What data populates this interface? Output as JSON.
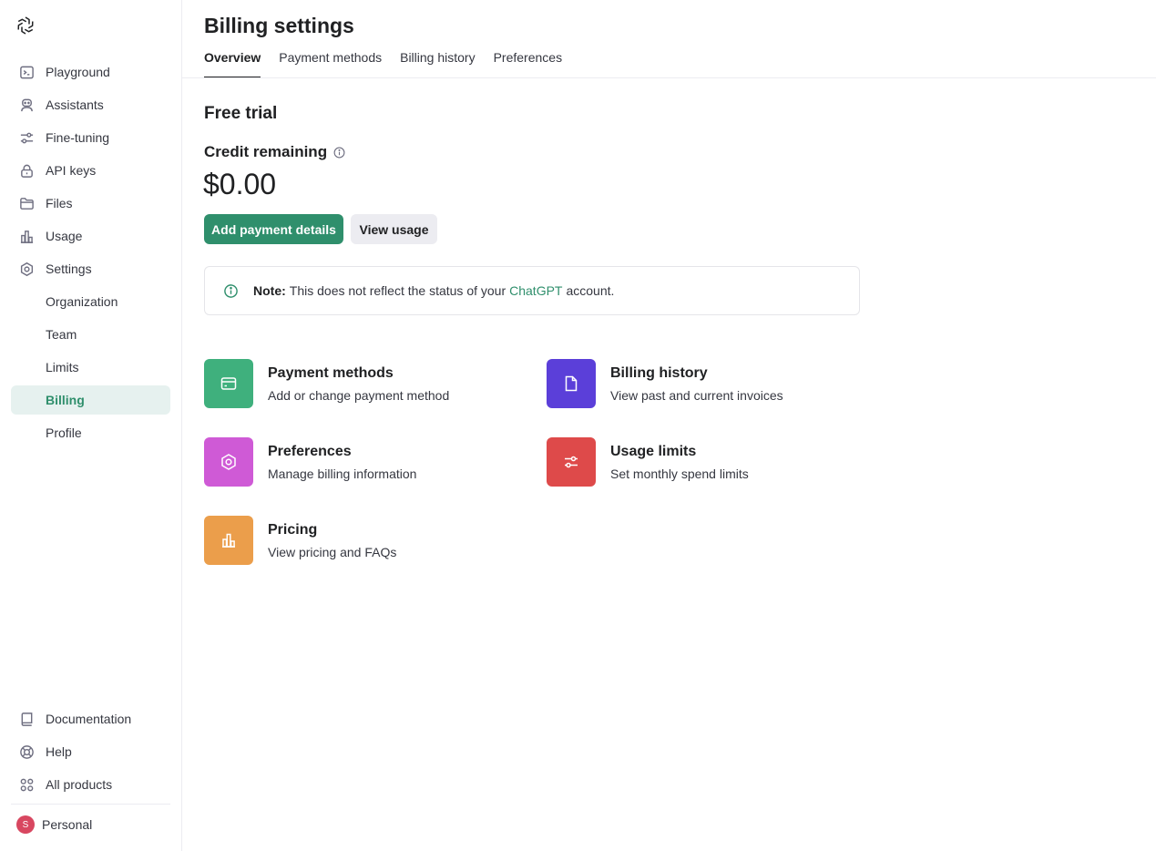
{
  "sidebar": {
    "nav": [
      {
        "label": "Playground",
        "icon": "terminal-icon"
      },
      {
        "label": "Assistants",
        "icon": "robot-icon"
      },
      {
        "label": "Fine-tuning",
        "icon": "sliders-icon"
      },
      {
        "label": "API keys",
        "icon": "lock-icon"
      },
      {
        "label": "Files",
        "icon": "folder-icon"
      },
      {
        "label": "Usage",
        "icon": "bar-chart-icon"
      },
      {
        "label": "Settings",
        "icon": "gear-icon"
      }
    ],
    "settings_sub": [
      "Organization",
      "Team",
      "Limits",
      "Billing",
      "Profile"
    ],
    "active_sub": "Billing",
    "bottom": [
      {
        "label": "Documentation",
        "icon": "book-icon"
      },
      {
        "label": "Help",
        "icon": "lifebuoy-icon"
      },
      {
        "label": "All products",
        "icon": "grid-icon"
      }
    ],
    "account": {
      "initial": "S",
      "label": "Personal"
    }
  },
  "header": {
    "title": "Billing settings",
    "tabs": [
      "Overview",
      "Payment methods",
      "Billing history",
      "Preferences"
    ],
    "active_tab": "Overview"
  },
  "overview": {
    "plan": "Free trial",
    "credit_label": "Credit remaining",
    "credit_amount": "$0.00",
    "primary_button": "Add payment details",
    "secondary_button": "View usage",
    "note": {
      "bold": "Note:",
      "text_before": "This does not reflect the status of your",
      "link": "ChatGPT",
      "text_after": "account."
    }
  },
  "cards": [
    {
      "title": "Payment methods",
      "desc": "Add or change payment method",
      "color": "#3fb07d",
      "icon": "credit-card-icon"
    },
    {
      "title": "Billing history",
      "desc": "View past and current invoices",
      "color": "#5b3fd9",
      "icon": "document-icon"
    },
    {
      "title": "Preferences",
      "desc": "Manage billing information",
      "color": "#cf5ad6",
      "icon": "gear-icon"
    },
    {
      "title": "Usage limits",
      "desc": "Set monthly spend limits",
      "color": "#de4a4a",
      "icon": "sliders-icon"
    },
    {
      "title": "Pricing",
      "desc": "View pricing and FAQs",
      "color": "#eb9e4b",
      "icon": "bar-chart-icon"
    }
  ],
  "colors": {
    "accent": "#2f8f6c",
    "active_bg": "#e6f1ef"
  }
}
